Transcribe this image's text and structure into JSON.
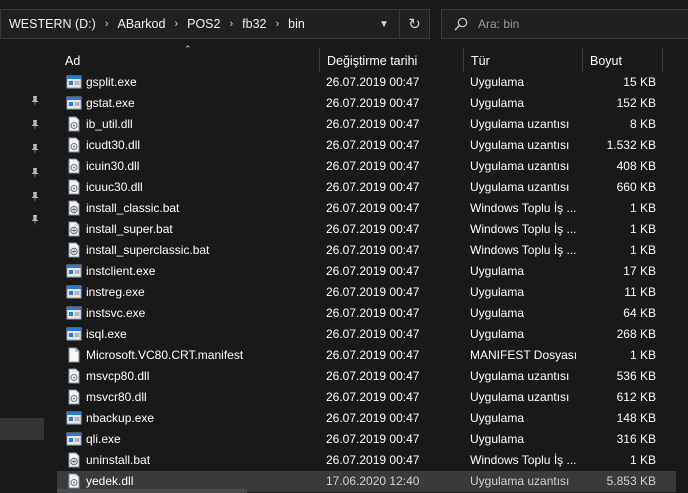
{
  "address": {
    "crumbs": [
      "WESTERN (D:)",
      "ABarkod",
      "POS2",
      "fb32",
      "bin"
    ],
    "separator": "›"
  },
  "search": {
    "placeholder": "Ara: bin"
  },
  "columns": {
    "name": "Ad",
    "date": "Değiştirme tarihi",
    "type": "Tür",
    "size": "Boyut"
  },
  "files": [
    {
      "name": "gsplit.exe",
      "date": "26.07.2019 00:47",
      "type": "Uygulama",
      "size": "15 KB",
      "icon": "exe-icon"
    },
    {
      "name": "gstat.exe",
      "date": "26.07.2019 00:47",
      "type": "Uygulama",
      "size": "152 KB",
      "icon": "exe-icon"
    },
    {
      "name": "ib_util.dll",
      "date": "26.07.2019 00:47",
      "type": "Uygulama uzantısı",
      "size": "8 KB",
      "icon": "dll-icon"
    },
    {
      "name": "icudt30.dll",
      "date": "26.07.2019 00:47",
      "type": "Uygulama uzantısı",
      "size": "1.532 KB",
      "icon": "dll-icon"
    },
    {
      "name": "icuin30.dll",
      "date": "26.07.2019 00:47",
      "type": "Uygulama uzantısı",
      "size": "408 KB",
      "icon": "dll-icon"
    },
    {
      "name": "icuuc30.dll",
      "date": "26.07.2019 00:47",
      "type": "Uygulama uzantısı",
      "size": "660 KB",
      "icon": "dll-icon"
    },
    {
      "name": "install_classic.bat",
      "date": "26.07.2019 00:47",
      "type": "Windows Toplu İş ...",
      "size": "1 KB",
      "icon": "bat-icon"
    },
    {
      "name": "install_super.bat",
      "date": "26.07.2019 00:47",
      "type": "Windows Toplu İş ...",
      "size": "1 KB",
      "icon": "bat-icon"
    },
    {
      "name": "install_superclassic.bat",
      "date": "26.07.2019 00:47",
      "type": "Windows Toplu İş ...",
      "size": "1 KB",
      "icon": "bat-icon"
    },
    {
      "name": "instclient.exe",
      "date": "26.07.2019 00:47",
      "type": "Uygulama",
      "size": "17 KB",
      "icon": "exe-icon"
    },
    {
      "name": "instreg.exe",
      "date": "26.07.2019 00:47",
      "type": "Uygulama",
      "size": "11 KB",
      "icon": "exe-icon"
    },
    {
      "name": "instsvc.exe",
      "date": "26.07.2019 00:47",
      "type": "Uygulama",
      "size": "64 KB",
      "icon": "exe-icon"
    },
    {
      "name": "isql.exe",
      "date": "26.07.2019 00:47",
      "type": "Uygulama",
      "size": "268 KB",
      "icon": "exe-icon"
    },
    {
      "name": "Microsoft.VC80.CRT.manifest",
      "date": "26.07.2019 00:47",
      "type": "MANIFEST Dosyası",
      "size": "1 KB",
      "icon": "file-icon"
    },
    {
      "name": "msvcp80.dll",
      "date": "26.07.2019 00:47",
      "type": "Uygulama uzantısı",
      "size": "536 KB",
      "icon": "dll-icon"
    },
    {
      "name": "msvcr80.dll",
      "date": "26.07.2019 00:47",
      "type": "Uygulama uzantısı",
      "size": "612 KB",
      "icon": "dll-icon"
    },
    {
      "name": "nbackup.exe",
      "date": "26.07.2019 00:47",
      "type": "Uygulama",
      "size": "148 KB",
      "icon": "exe-icon"
    },
    {
      "name": "qli.exe",
      "date": "26.07.2019 00:47",
      "type": "Uygulama",
      "size": "316 KB",
      "icon": "exe-icon"
    },
    {
      "name": "uninstall.bat",
      "date": "26.07.2019 00:47",
      "type": "Windows Toplu İş ...",
      "size": "1 KB",
      "icon": "bat-icon"
    },
    {
      "name": "yedek.dll",
      "date": "17.06.2020 12:40",
      "type": "Uygulama uzantısı",
      "size": "5.853 KB",
      "icon": "dll-icon",
      "selected": true
    }
  ],
  "colors": {
    "background": "#191919",
    "selection": "#3a3a3a",
    "text": "#ffffff"
  }
}
